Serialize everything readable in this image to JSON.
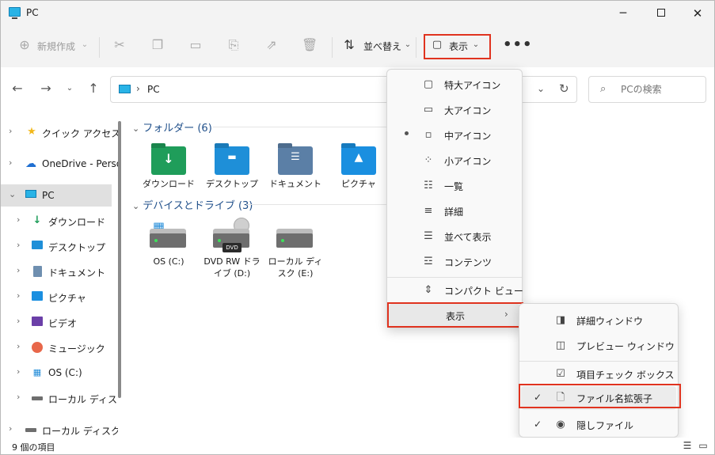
{
  "window": {
    "title": "PC"
  },
  "toolbar": {
    "new_label": "新規作成",
    "sort_label": "並べ替え",
    "view_label": "表示",
    "more_label": "•••"
  },
  "address": {
    "path": "PC",
    "search_placeholder": "PCの検索"
  },
  "sidebar": {
    "items": [
      {
        "label": "クイック アクセス",
        "icon": "star-icon"
      },
      {
        "label": "OneDrive - Perso",
        "icon": "cloud-icon"
      },
      {
        "label": "PC",
        "icon": "pc-icon"
      },
      {
        "label": "ダウンロード",
        "icon": "download-icon"
      },
      {
        "label": "デスクトップ",
        "icon": "desktop-icon"
      },
      {
        "label": "ドキュメント",
        "icon": "document-icon"
      },
      {
        "label": "ピクチャ",
        "icon": "picture-icon"
      },
      {
        "label": "ビデオ",
        "icon": "video-icon"
      },
      {
        "label": "ミュージック",
        "icon": "music-icon"
      },
      {
        "label": "OS (C:)",
        "icon": "windows-drive-icon"
      },
      {
        "label": "ローカル ディスク (",
        "icon": "drive-icon"
      },
      {
        "label": "ローカル ディスク (E:",
        "icon": "drive-icon"
      }
    ]
  },
  "main": {
    "folders_header": "フォルダー (6)",
    "devices_header": "デバイスとドライブ (3)",
    "folders": [
      {
        "label": "ダウンロード",
        "color": "#1f9d5a"
      },
      {
        "label": "デスクトップ",
        "color": "#1e8fd8"
      },
      {
        "label": "ドキュメント",
        "color": "#5b7fa6"
      },
      {
        "label": "ピクチャ",
        "color": "#1a8fe0"
      }
    ],
    "drives": [
      {
        "label": "OS (C:)"
      },
      {
        "label": "DVD RW ドライブ (D:)",
        "badge": "DVD"
      },
      {
        "label": "ローカル ディスク (E:)"
      }
    ]
  },
  "view_menu": {
    "items": [
      {
        "label": "特大アイコン",
        "icon": "extra-large-icons-icon"
      },
      {
        "label": "大アイコン",
        "icon": "large-icons-icon"
      },
      {
        "label": "中アイコン",
        "icon": "medium-icons-icon",
        "selected": true
      },
      {
        "label": "小アイコン",
        "icon": "small-icons-icon"
      },
      {
        "label": "一覧",
        "icon": "list-icon"
      },
      {
        "label": "詳細",
        "icon": "details-icon"
      },
      {
        "label": "並べて表示",
        "icon": "tiles-icon"
      },
      {
        "label": "コンテンツ",
        "icon": "content-icon"
      }
    ],
    "compact_label": "コンパクト ビュー",
    "show_label": "表示"
  },
  "show_submenu": {
    "items": [
      {
        "label": "詳細ウィンドウ",
        "icon": "details-pane-icon",
        "checked": false
      },
      {
        "label": "プレビュー ウィンドウ",
        "icon": "preview-pane-icon",
        "checked": false
      },
      {
        "label": "項目チェック ボックス",
        "icon": "item-checkbox-icon",
        "checked": false
      },
      {
        "label": "ファイル名拡張子",
        "icon": "file-extension-icon",
        "checked": true
      },
      {
        "label": "隠しファイル",
        "icon": "hidden-files-icon",
        "checked": true
      }
    ]
  },
  "status": {
    "item_count": "9 個の項目"
  },
  "colors": {
    "highlight_red": "#e0331f",
    "group_header": "#1f4f8a"
  }
}
